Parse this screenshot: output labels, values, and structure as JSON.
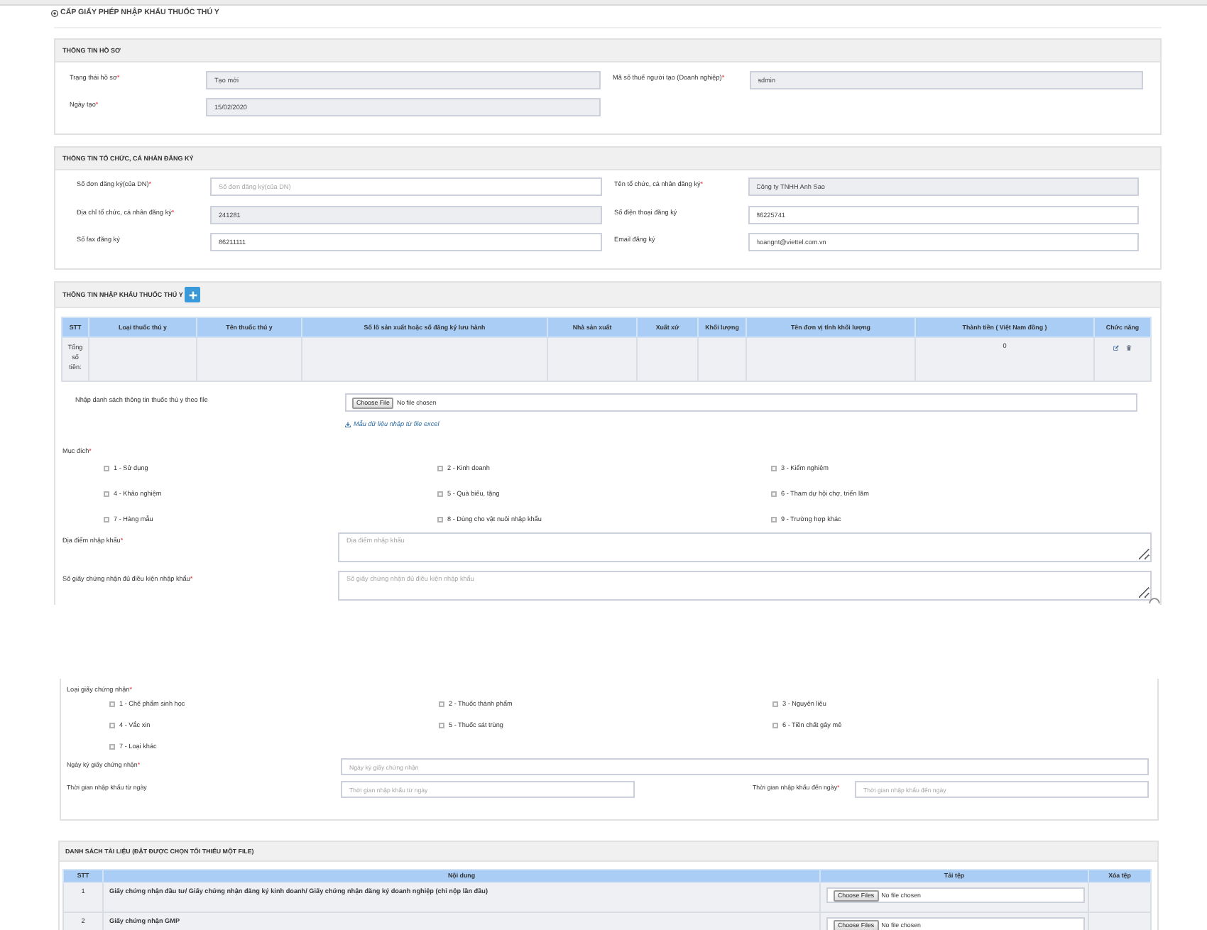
{
  "page_title": "CẤP GIẤY PHÉP NHẬP KHẨU THUỐC THÚ Y",
  "record_info": {
    "title": "THÔNG TIN HỒ SƠ",
    "left_fields": [
      {
        "label": "Trạng thái hồ sơ",
        "required_mark": "*",
        "value": "Tạo mới",
        "disabled": true
      },
      {
        "label": "Ngày tạo",
        "required_mark": "*",
        "value": "15/02/2020",
        "disabled": true
      }
    ],
    "right_fields": [
      {
        "label": "Mã số thuế người tạo (Doanh nghiệp)",
        "required_mark": "*",
        "value": "admin",
        "disabled": true
      }
    ]
  },
  "registrant_info": {
    "title": "THÔNG TIN TỔ CHỨC, CÁ NHÂN ĐĂNG KÝ",
    "left_fields": [
      {
        "label": "Số đơn đăng ký(của DN)",
        "required_mark": "*",
        "placeholder": "Số đơn đăng ký(của DN)",
        "disabled": false
      },
      {
        "label": "Địa chỉ tổ chức, cá nhân đăng ký",
        "required_mark": "*",
        "value": "241281",
        "disabled": true
      },
      {
        "label": "Số fax đăng ký",
        "value": "86211111",
        "disabled": false
      }
    ],
    "right_fields": [
      {
        "label": "Tên tổ chức, cá nhân đăng ký",
        "required_mark": "*",
        "value": "Công ty TNHH Anh Sao",
        "disabled": true
      },
      {
        "label": "Số điện thoại đăng ký",
        "value": "86225741",
        "disabled": false
      },
      {
        "label": "Email đăng ký",
        "value": "hoangnt@viettel.com.vn",
        "disabled": false
      }
    ]
  },
  "import_info": {
    "title": "THÔNG TIN NHẬP KHẨU THUỐC THÚ Y",
    "table": {
      "columns": [
        "STT",
        "Loại thuốc thú y",
        "Tên thuốc thú y",
        "Số lô sản xuất hoặc số đăng ký lưu hành",
        "Nhà sản xuất",
        "Xuất xứ",
        "Khối lượng",
        "Tên đơn vị tính khối lượng",
        "Thành tiền ( Việt Nam đồng )",
        "Chức năng"
      ],
      "total_row": {
        "label": "Tổng số tiền:",
        "amount": "0"
      }
    },
    "file_import": {
      "label": "Nhập danh sách thông tin thuốc thú y theo file",
      "button": "Choose File",
      "status": "No file chosen",
      "template_link": "Mẫu dữ liệu nhập từ file excel"
    },
    "purpose": {
      "label": "Mục đích",
      "required_mark": "*",
      "options": [
        {
          "label": "1 - Sử dụng",
          "checked": false
        },
        {
          "label": "2 - Kinh doanh",
          "checked": false
        },
        {
          "label": "3 - Kiểm nghiệm",
          "checked": false
        },
        {
          "label": "4 - Khảo nghiệm",
          "checked": false
        },
        {
          "label": "5 - Quà biếu, tặng",
          "checked": false
        },
        {
          "label": "6 - Tham dự hội chợ, triển lãm",
          "checked": false
        },
        {
          "label": "7 - Hàng mẫu",
          "checked": false
        },
        {
          "label": "8 - Dùng cho vật nuôi nhập khẩu",
          "checked": false
        },
        {
          "label": "9 - Trường hợp khác",
          "checked": false
        }
      ]
    },
    "text_areas": [
      {
        "label": "Địa điểm nhập khẩu",
        "required_mark": "*",
        "placeholder": "Địa điểm nhập khẩu"
      },
      {
        "label": "Số giấy chứng nhận đủ điều kiện nhập khẩu",
        "required_mark": "*",
        "placeholder": "Số giấy chứng nhận đủ điều kiện nhập khẩu"
      }
    ],
    "certificate_type": {
      "label": "Loại giấy chứng nhận",
      "required_mark": "*",
      "options": [
        {
          "label": "1 - Chế phẩm sinh học",
          "checked": false
        },
        {
          "label": "2 - Thuốc thành phẩm",
          "checked": false
        },
        {
          "label": "3 - Nguyên liệu",
          "checked": false
        },
        {
          "label": "4 - Vắc xin",
          "checked": false
        },
        {
          "label": "5 - Thuốc sát trùng",
          "checked": false
        },
        {
          "label": "6 - Tiền chất gây mê",
          "checked": false
        },
        {
          "label": "7 - Loại khác",
          "checked": false
        }
      ]
    },
    "signing_date": {
      "label": "Ngày ký giấy chứng nhận",
      "required_mark": "*",
      "placeholder": "Ngày ký giấy chứng nhận"
    },
    "import_period": [
      {
        "label": "Thời gian nhập khẩu từ ngày",
        "placeholder": "Thời gian nhập khẩu từ ngày"
      },
      {
        "label": "Thời gian nhập khẩu đến ngày",
        "required_mark": "*",
        "placeholder": "Thời gian nhập khẩu đến ngày"
      }
    ]
  },
  "documents": {
    "title": "DANH SÁCH TÀI LIỆU (ĐẶT ĐƯỢC CHỌN TỐI THIỂU MỘT FILE)",
    "columns": [
      "STT",
      "Nội dung",
      "Tải tệp",
      "Xóa tệp"
    ],
    "rows": [
      {
        "stt": "1",
        "content": "Giấy chứng nhận đầu tư/ Giấy chứng nhận đăng ký kinh doanh/ Giấy chứng nhận đăng ký doanh nghiệp (chỉ nộp lần đầu)",
        "button": "Choose Files",
        "status": "No file chosen"
      },
      {
        "stt": "2",
        "content": "Giấy chứng nhận GMP",
        "button": "Choose Files",
        "status": "No file chosen"
      }
    ]
  }
}
